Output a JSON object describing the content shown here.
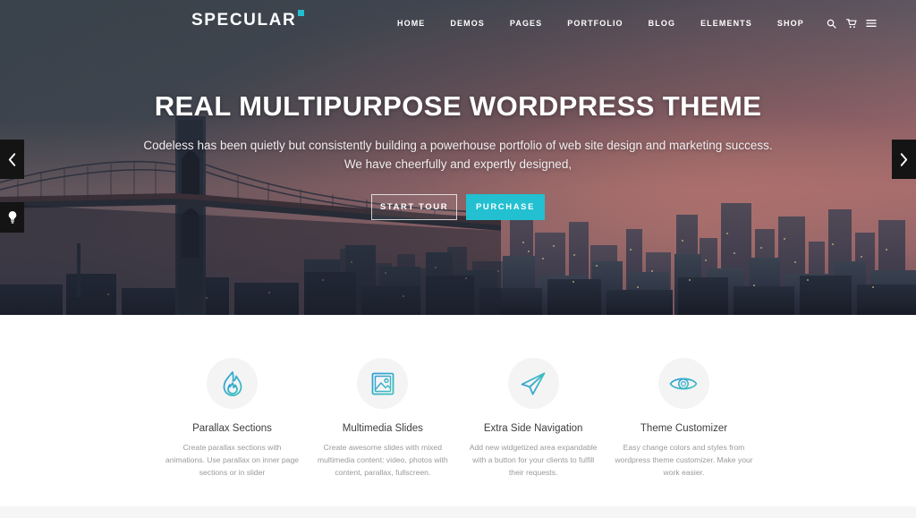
{
  "header": {
    "logo_text": "SPECULAR",
    "nav_items": [
      {
        "label": "HOME"
      },
      {
        "label": "DEMOS"
      },
      {
        "label": "PAGES"
      },
      {
        "label": "PORTFOLIO"
      },
      {
        "label": "BLOG"
      },
      {
        "label": "ELEMENTS"
      },
      {
        "label": "SHOP"
      }
    ],
    "icons": [
      {
        "name": "search-icon"
      },
      {
        "name": "cart-icon"
      },
      {
        "name": "hamburger-menu-icon"
      }
    ]
  },
  "hero": {
    "title": "REAL MULTIPURPOSE WORDPRESS THEME",
    "subtitle_line1": "Codeless has been quietly but consistently building a powerhouse portfolio of web site design and marketing success.",
    "subtitle_line2": "We have cheerfully and expertly designed,",
    "primary_button": "START TOUR",
    "secondary_button": "PURCHASE",
    "prev_arrow": "‹",
    "next_arrow": "›",
    "bulb_control": "lightbulb-icon",
    "background_image": "brooklyn-bridge-new-york-city-skyline-at-sunset"
  },
  "features": [
    {
      "icon": "flame-icon",
      "title": "Parallax Sections",
      "description": "Create parallax sections with animations. Use parallax on inner page sections or in slider"
    },
    {
      "icon": "image-icon",
      "title": "Multimedia Slides",
      "description": "Create awesome slides with mixed multimedia content: video, photos with content, parallax, fullscreen."
    },
    {
      "icon": "paper-plane-icon",
      "title": "Extra Side Navigation",
      "description": "Add new widgetized area expandable with a button for your clients to fulfill their requests."
    },
    {
      "icon": "eye-icon",
      "title": "Theme Customizer",
      "description": "Easy change colors and styles from wordpress theme customizer. Make your work easier."
    }
  ],
  "colors": {
    "accent_teal": "#22c0d0",
    "icon_teal": "#35b8c6",
    "icon_blue": "#2f9fd6",
    "text_dark": "#3d3d3d",
    "text_muted": "#9a9a9a",
    "hero_button_fill": "#22c0d0",
    "arrow_background": "#141414",
    "features_background": "#ffffff",
    "footer_band": "#f5f5f5"
  }
}
